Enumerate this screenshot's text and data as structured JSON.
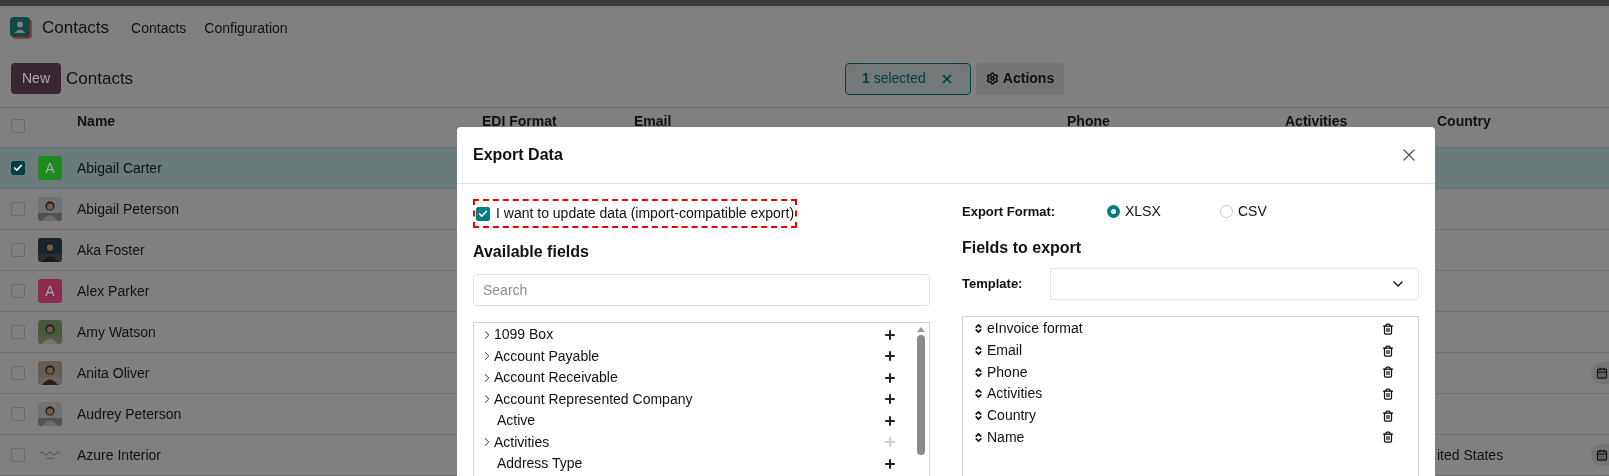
{
  "app": {
    "name": "Contacts",
    "menu": [
      "Contacts",
      "Configuration"
    ]
  },
  "control_panel": {
    "new_button": "New",
    "breadcrumb": "Contacts",
    "selection": "**1** selected",
    "actions": "Actions"
  },
  "table": {
    "select_all_checked": false,
    "columns": [
      "Name",
      "EDI Format",
      "Email",
      "Phone",
      "Activities",
      "Country"
    ],
    "rows": [
      {
        "name": "Abigail Carter",
        "selected": true,
        "avatar": {
          "kind": "letter",
          "letter": "A",
          "color": "#1f8a1f"
        },
        "has_activity": false
      },
      {
        "name": "Abigail Peterson",
        "selected": false,
        "has_activity": false
      },
      {
        "name": "Aka Foster",
        "selected": false,
        "has_activity": false
      },
      {
        "name": "Alex Parker",
        "selected": false,
        "avatar": {
          "kind": "letter",
          "letter": "A",
          "color": "#8c2a4f"
        },
        "has_activity": false
      },
      {
        "name": "Amy Watson",
        "selected": false,
        "has_activity": false
      },
      {
        "name": "Anita Oliver",
        "selected": false,
        "has_activity": true
      },
      {
        "name": "Audrey Peterson",
        "selected": false,
        "has_activity": false
      },
      {
        "name": "Azure Interior",
        "selected": false,
        "avatar": {
          "kind": "logo"
        },
        "country": "ited States",
        "has_activity": true
      }
    ]
  },
  "dialog": {
    "title": "Export Data",
    "import_compatible": {
      "label": "I want to update data (import-compatible export)",
      "checked": true
    },
    "available_fields": {
      "title": "Available fields",
      "search_placeholder": "Search",
      "items": [
        {
          "label": "1099 Box",
          "expandable": true,
          "disabled": false
        },
        {
          "label": "Account Payable",
          "expandable": true,
          "disabled": false
        },
        {
          "label": "Account Receivable",
          "expandable": true,
          "disabled": false
        },
        {
          "label": "Account Represented Company",
          "expandable": true,
          "disabled": false
        },
        {
          "label": "Active",
          "expandable": false,
          "disabled": false
        },
        {
          "label": "Activities",
          "expandable": true,
          "disabled": true
        },
        {
          "label": "Address Type",
          "expandable": false,
          "disabled": false
        }
      ]
    },
    "export_format": {
      "label": "Export Format:",
      "options": [
        {
          "label": "XLSX",
          "selected": true
        },
        {
          "label": "CSV",
          "selected": false
        }
      ]
    },
    "fields_to_export": {
      "title": "Fields to export",
      "template_label": "Template:",
      "items": [
        "eInvoice format",
        "Email",
        "Phone",
        "Activities",
        "Country",
        "Name"
      ]
    }
  }
}
